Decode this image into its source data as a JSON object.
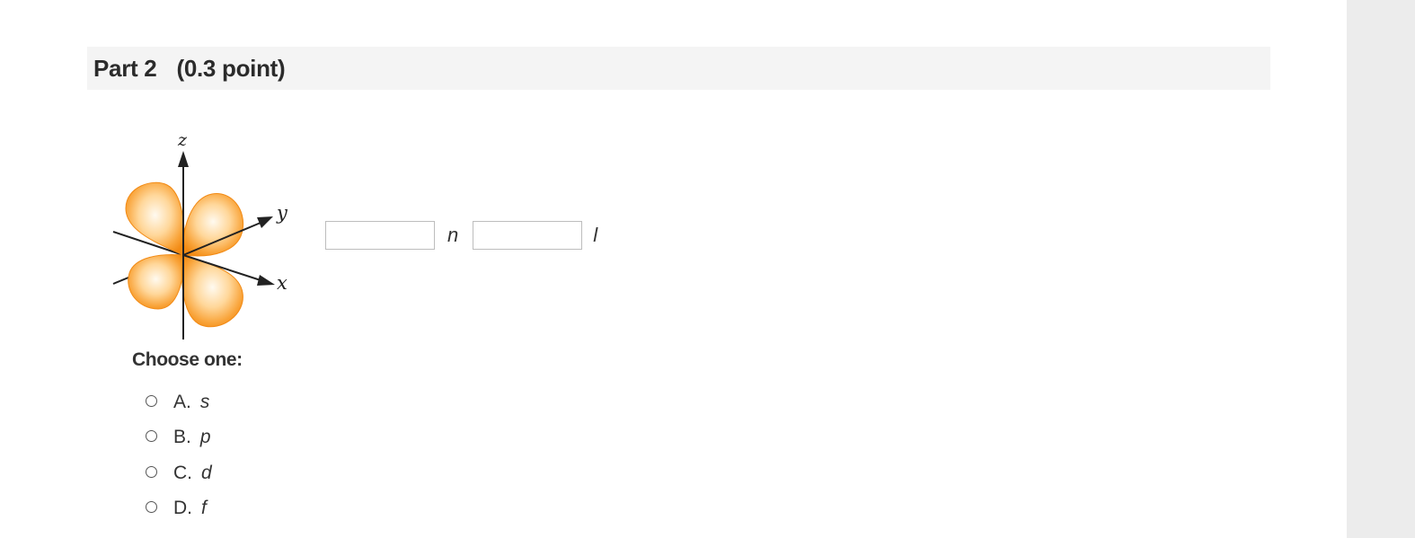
{
  "part": {
    "title": "Part 2",
    "points": "(0.3 point)"
  },
  "orbital_figure": {
    "axis_labels": {
      "z": "z",
      "y": "y",
      "x": "x"
    },
    "lobe_color": "#f7941d",
    "lobe_highlight": "#fff6e8"
  },
  "answer_fields": [
    {
      "value": "",
      "label": "n"
    },
    {
      "value": "",
      "label": "l"
    }
  ],
  "question": {
    "prompt": "Choose one:",
    "options": [
      {
        "letter": "A.",
        "value": "s"
      },
      {
        "letter": "B.",
        "value": "p"
      },
      {
        "letter": "C.",
        "value": "d"
      },
      {
        "letter": "D.",
        "value": "f"
      }
    ]
  },
  "colors": {
    "header_background": "#f4f4f4",
    "rail_background": "#ececec",
    "text": "#333333"
  }
}
